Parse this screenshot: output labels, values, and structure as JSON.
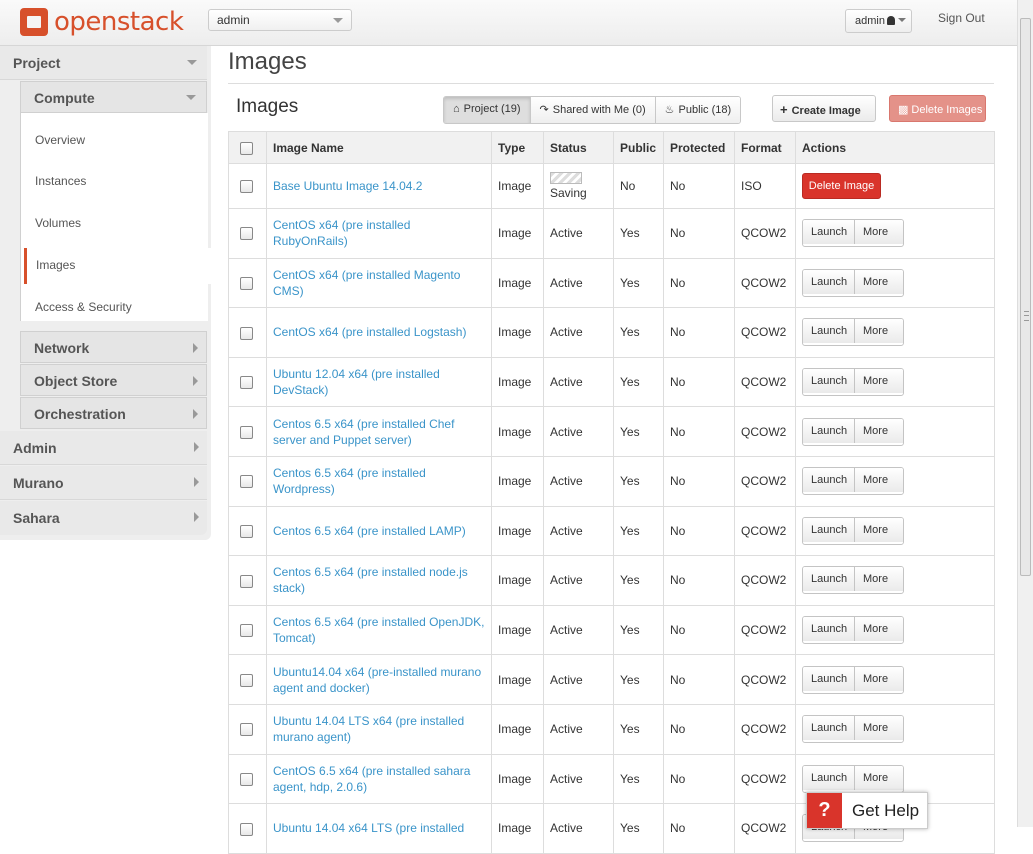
{
  "header": {
    "logo_text": "openstack",
    "project_select": "admin",
    "user_menu": "admin",
    "sign_out": "Sign Out"
  },
  "sidebar": {
    "project": "Project",
    "compute": "Compute",
    "compute_items": [
      "Overview",
      "Instances",
      "Volumes",
      "Images",
      "Access & Security"
    ],
    "network": "Network",
    "object_store": "Object Store",
    "orchestration": "Orchestration",
    "admin": "Admin",
    "murano": "Murano",
    "sahara": "Sahara"
  },
  "page": {
    "title": "Images",
    "table_title": "Images",
    "tabs": [
      "Project (19)",
      "Shared with Me (0)",
      "Public (18)"
    ],
    "create_image": "Create Image",
    "delete_images": "Delete Images"
  },
  "table": {
    "columns": [
      "Image Name",
      "Type",
      "Status",
      "Public",
      "Protected",
      "Format",
      "Actions"
    ],
    "rows": [
      {
        "name": "Base Ubuntu Image 14.04.2",
        "type": "Image",
        "status": "Saving",
        "public": "No",
        "protected": "No",
        "format": "ISO",
        "action": "Delete Image"
      },
      {
        "name": "CentOS x64 (pre installed RubyOnRails)",
        "type": "Image",
        "status": "Active",
        "public": "Yes",
        "protected": "No",
        "format": "QCOW2",
        "action": "Launch",
        "more": "More"
      },
      {
        "name": "CentOS x64 (pre installed Magento CMS)",
        "type": "Image",
        "status": "Active",
        "public": "Yes",
        "protected": "No",
        "format": "QCOW2",
        "action": "Launch",
        "more": "More"
      },
      {
        "name": "CentOS x64 (pre installed Logstash)",
        "type": "Image",
        "status": "Active",
        "public": "Yes",
        "protected": "No",
        "format": "QCOW2",
        "action": "Launch",
        "more": "More"
      },
      {
        "name": "Ubuntu 12.04 x64 (pre installed DevStack)",
        "type": "Image",
        "status": "Active",
        "public": "Yes",
        "protected": "No",
        "format": "QCOW2",
        "action": "Launch",
        "more": "More"
      },
      {
        "name": "Centos 6.5 x64 (pre installed Chef server and Puppet server)",
        "type": "Image",
        "status": "Active",
        "public": "Yes",
        "protected": "No",
        "format": "QCOW2",
        "action": "Launch",
        "more": "More"
      },
      {
        "name": "Centos 6.5 x64 (pre installed Wordpress)",
        "type": "Image",
        "status": "Active",
        "public": "Yes",
        "protected": "No",
        "format": "QCOW2",
        "action": "Launch",
        "more": "More"
      },
      {
        "name": "Centos 6.5 x64 (pre installed LAMP)",
        "type": "Image",
        "status": "Active",
        "public": "Yes",
        "protected": "No",
        "format": "QCOW2",
        "action": "Launch",
        "more": "More"
      },
      {
        "name": "Centos 6.5 x64 (pre installed node.js stack)",
        "type": "Image",
        "status": "Active",
        "public": "Yes",
        "protected": "No",
        "format": "QCOW2",
        "action": "Launch",
        "more": "More"
      },
      {
        "name": "Centos 6.5 x64 (pre installed OpenJDK, Tomcat)",
        "type": "Image",
        "status": "Active",
        "public": "Yes",
        "protected": "No",
        "format": "QCOW2",
        "action": "Launch",
        "more": "More"
      },
      {
        "name": "Ubuntu14.04 x64 (pre-installed murano agent and docker)",
        "type": "Image",
        "status": "Active",
        "public": "Yes",
        "protected": "No",
        "format": "QCOW2",
        "action": "Launch",
        "more": "More"
      },
      {
        "name": "Ubuntu 14.04 LTS x64 (pre installed murano agent)",
        "type": "Image",
        "status": "Active",
        "public": "Yes",
        "protected": "No",
        "format": "QCOW2",
        "action": "Launch",
        "more": "More"
      },
      {
        "name": "CentOS 6.5 x64 (pre installed sahara agent, hdp, 2.0.6)",
        "type": "Image",
        "status": "Active",
        "public": "Yes",
        "protected": "No",
        "format": "QCOW2",
        "action": "Launch",
        "more": "More"
      },
      {
        "name": "Ubuntu 14.04 x64 LTS (pre installed",
        "type": "Image",
        "status": "Active",
        "public": "Yes",
        "protected": "No",
        "format": "QCOW2",
        "action": "Launch",
        "more": "More"
      }
    ]
  },
  "help": {
    "icon": "?",
    "label": "Get Help"
  },
  "colors": {
    "brand": "#d7502b",
    "link": "#3a94c9",
    "danger": "#d9342b"
  }
}
